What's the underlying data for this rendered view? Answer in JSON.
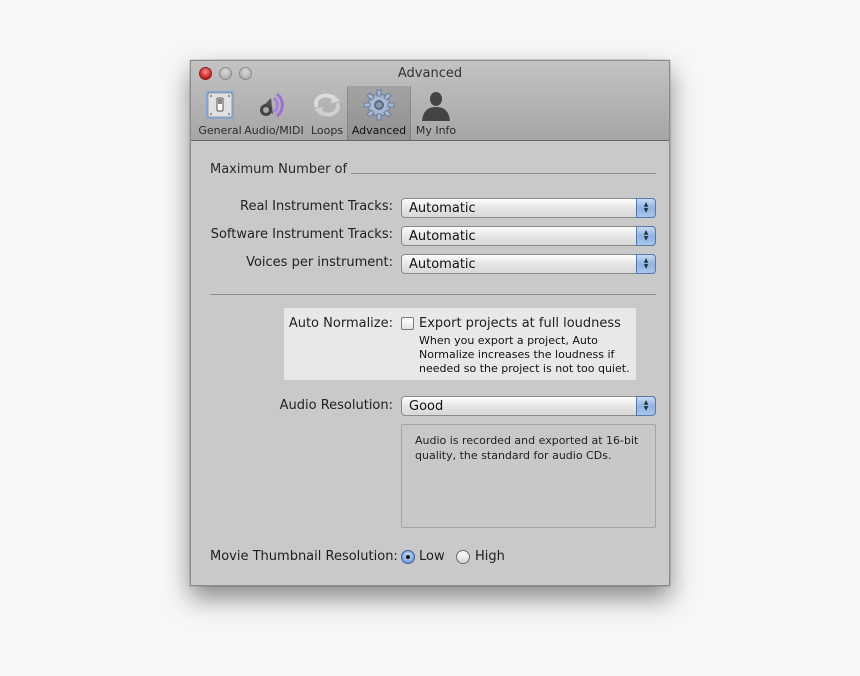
{
  "window": {
    "title": "Advanced",
    "traffic_lights": [
      "close",
      "minimize",
      "zoom"
    ]
  },
  "toolbar": {
    "tabs": [
      {
        "label": "General",
        "icon": "switch-icon",
        "active": false
      },
      {
        "label": "Audio/MIDI",
        "icon": "speaker-icon",
        "active": false
      },
      {
        "label": "Loops",
        "icon": "loop-arrows-icon",
        "active": false
      },
      {
        "label": "Advanced",
        "icon": "gear-icon",
        "active": true
      },
      {
        "label": "My Info",
        "icon": "user-silhouette-icon",
        "active": false
      }
    ]
  },
  "max_group": {
    "title": "Maximum Number of",
    "rows": [
      {
        "label": "Real Instrument Tracks:",
        "value": "Automatic"
      },
      {
        "label": "Software Instrument Tracks:",
        "value": "Automatic"
      },
      {
        "label": "Voices per instrument:",
        "value": "Automatic"
      }
    ]
  },
  "auto_normalize": {
    "label": "Auto Normalize:",
    "checkbox_label": "Export projects at full loudness",
    "checked": false,
    "description": [
      "When you export a project, Auto",
      "Normalize increases the loudness if",
      "needed so the project is not too quiet."
    ]
  },
  "audio_resolution": {
    "label": "Audio Resolution:",
    "value": "Good",
    "info": [
      "Audio is recorded and exported at 16-bit",
      "quality, the standard for audio CDs."
    ]
  },
  "movie_thumbnail": {
    "label": "Movie Thumbnail Resolution:",
    "options": [
      {
        "label": "Low",
        "selected": true
      },
      {
        "label": "High",
        "selected": false
      }
    ]
  }
}
